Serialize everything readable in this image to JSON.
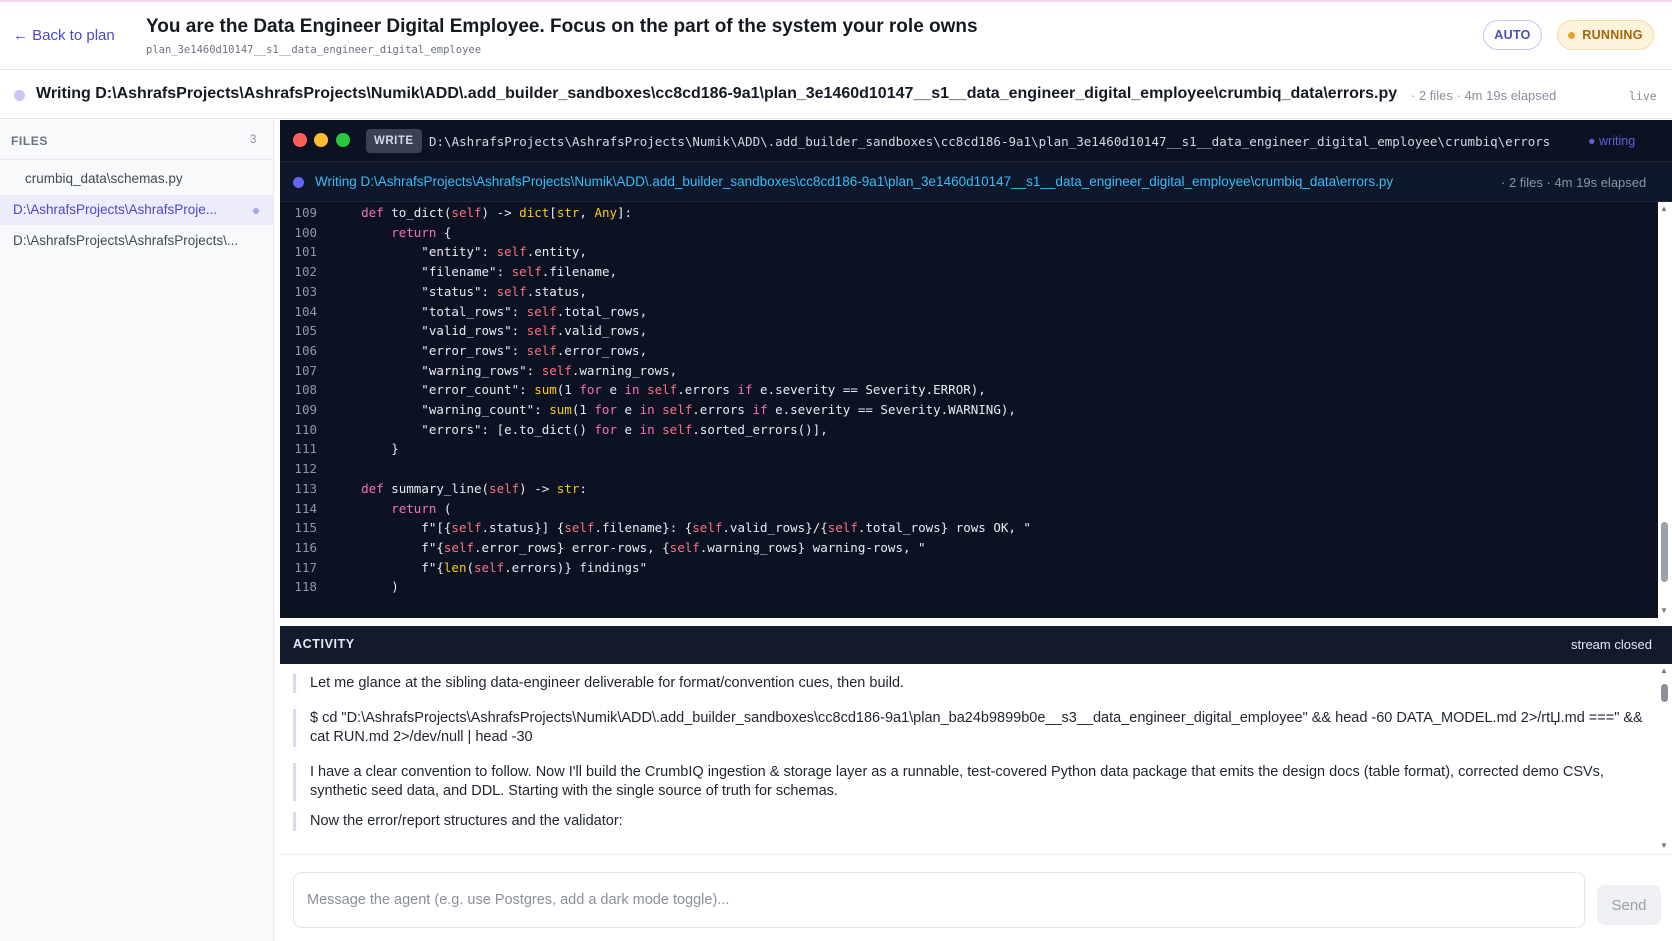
{
  "header": {
    "back_label": "← Back to plan",
    "title": "You are the Data Engineer Digital Employee. Focus on the part of the system your role owns",
    "subtitle": "plan_3e1460d10147__s1__data_engineer_digital_employee",
    "badges": {
      "auto": "AUTO",
      "running": "RUNNING"
    }
  },
  "status": {
    "text": "Writing D:\\AshrafsProjects\\AshrafsProjects\\Numik\\ADD\\.add_builder_sandboxes\\cc8cd186-9a1\\plan_3e1460d10147__s1__data_engineer_digital_employee\\crumbiq_data\\errors.py",
    "meta": "· 2 files · 4m 19s elapsed",
    "live": "live"
  },
  "sidebar": {
    "heading": "FILES",
    "count": "3",
    "files": [
      {
        "label": "crumbiq_data\\schemas.py"
      },
      {
        "label": "D:\\AshrafsProjects\\AshrafsProje..."
      },
      {
        "label": "D:\\AshrafsProjects\\AshrafsProjects\\..."
      }
    ]
  },
  "editor": {
    "mode": "WRITE",
    "path": "D:\\AshrafsProjects\\AshrafsProjects\\Numik\\ADD\\.add_builder_sandboxes\\cc8cd186-9a1\\plan_3e1460d10147__s1__data_engineer_digital_employee\\crumbiq\\errors",
    "indicator": "● writing",
    "sub_text": "Writing D:\\AshrafsProjects\\AshrafsProjects\\Numik\\ADD\\.add_builder_sandboxes\\cc8cd186-9a1\\plan_3e1460d10147__s1__data_engineer_digital_employee\\crumbiq_data\\errors.py",
    "sub_meta": "· 2 files · 4m 19s elapsed",
    "lines": [
      {
        "n": "109",
        "code": "    def to_dict(self) -> dict[str, Any]:"
      },
      {
        "n": "100",
        "code": "        return {"
      },
      {
        "n": "101",
        "code": "            \"entity\": self.entity,"
      },
      {
        "n": "102",
        "code": "            \"filename\": self.filename,"
      },
      {
        "n": "103",
        "code": "            \"status\": self.status,"
      },
      {
        "n": "104",
        "code": "            \"total_rows\": self.total_rows,"
      },
      {
        "n": "105",
        "code": "            \"valid_rows\": self.valid_rows,"
      },
      {
        "n": "106",
        "code": "            \"error_rows\": self.error_rows,"
      },
      {
        "n": "107",
        "code": "            \"warning_rows\": self.warning_rows,"
      },
      {
        "n": "108",
        "code": "            \"error_count\": sum(1 for e in self.errors if e.severity == Severity.ERROR),"
      },
      {
        "n": "109",
        "code": "            \"warning_count\": sum(1 for e in self.errors if e.severity == Severity.WARNING),"
      },
      {
        "n": "110",
        "code": "            \"errors\": [e.to_dict() for e in self.sorted_errors()],"
      },
      {
        "n": "111",
        "code": "        }"
      },
      {
        "n": "112",
        "code": ""
      },
      {
        "n": "113",
        "code": "    def summary_line(self) -> str:"
      },
      {
        "n": "114",
        "code": "        return ("
      },
      {
        "n": "115",
        "code": "            f\"[{self.status}] {self.filename}: {self.valid_rows}/{self.total_rows} rows OK, \""
      },
      {
        "n": "116",
        "code": "            f\"{self.error_rows} error-rows, {self.warning_rows} warning-rows, \""
      },
      {
        "n": "117",
        "code": "            f\"{len(self.errors)} findings\""
      },
      {
        "n": "118",
        "code": "        )"
      }
    ]
  },
  "activity": {
    "title": "ACTIVITY",
    "status": "stream closed",
    "messages": [
      {
        "text": "Let me glance at the sibling data-engineer deliverable for format/convention cues, then build."
      },
      {
        "text": "$ cd \"D:\\AshrafsProjects\\AshrafsProjects\\Numik\\ADD\\.add_builder_sandboxes\\cc8cd186-9a1\\plan_ba24b9899b0e__s3__data_engineer_digital_employee\" && head -60 DATA_MODEL.md 2>/rtЏ.md ===\" && cat RUN.md 2>/dev/null | head -30"
      },
      {
        "text": "I have a clear convention to follow. Now I'll build the CrumbIQ ingestion & storage layer as a runnable, test-covered Python data package that emits the design docs (table format), corrected demo CSVs, synthetic seed data, and DDL. Starting with the single source of truth for schemas."
      },
      {
        "text": "Now the error/report structures and the validator:"
      }
    ]
  },
  "composer": {
    "placeholder": "Message the agent (e.g. use Postgres, add a dark mode toggle)...",
    "value": "",
    "send_label": "Send"
  }
}
